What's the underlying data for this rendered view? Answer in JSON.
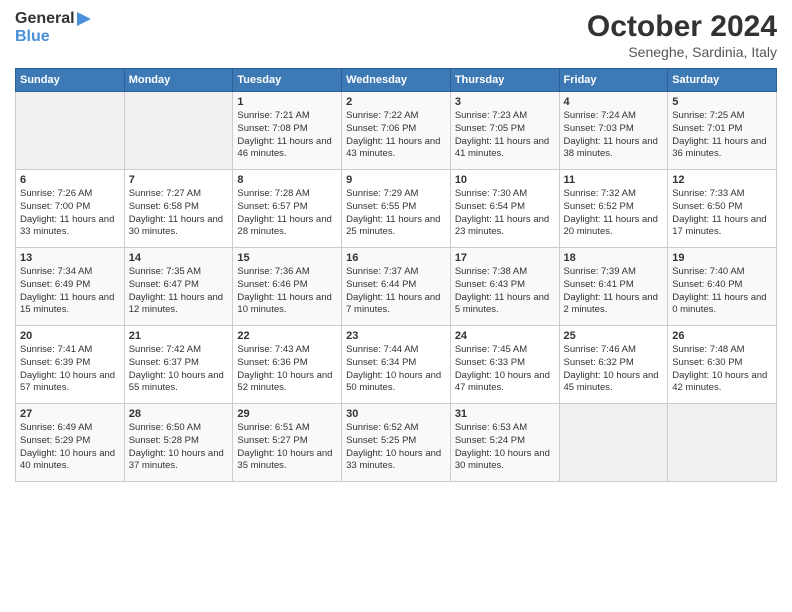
{
  "header": {
    "logo": {
      "line1": "General",
      "line2": "Blue"
    },
    "title": "October 2024",
    "subtitle": "Seneghe, Sardinia, Italy"
  },
  "weekdays": [
    "Sunday",
    "Monday",
    "Tuesday",
    "Wednesday",
    "Thursday",
    "Friday",
    "Saturday"
  ],
  "weeks": [
    [
      {
        "day": "",
        "info": ""
      },
      {
        "day": "",
        "info": ""
      },
      {
        "day": "1",
        "info": "Sunrise: 7:21 AM\nSunset: 7:08 PM\nDaylight: 11 hours and 46 minutes."
      },
      {
        "day": "2",
        "info": "Sunrise: 7:22 AM\nSunset: 7:06 PM\nDaylight: 11 hours and 43 minutes."
      },
      {
        "day": "3",
        "info": "Sunrise: 7:23 AM\nSunset: 7:05 PM\nDaylight: 11 hours and 41 minutes."
      },
      {
        "day": "4",
        "info": "Sunrise: 7:24 AM\nSunset: 7:03 PM\nDaylight: 11 hours and 38 minutes."
      },
      {
        "day": "5",
        "info": "Sunrise: 7:25 AM\nSunset: 7:01 PM\nDaylight: 11 hours and 36 minutes."
      }
    ],
    [
      {
        "day": "6",
        "info": "Sunrise: 7:26 AM\nSunset: 7:00 PM\nDaylight: 11 hours and 33 minutes."
      },
      {
        "day": "7",
        "info": "Sunrise: 7:27 AM\nSunset: 6:58 PM\nDaylight: 11 hours and 30 minutes."
      },
      {
        "day": "8",
        "info": "Sunrise: 7:28 AM\nSunset: 6:57 PM\nDaylight: 11 hours and 28 minutes."
      },
      {
        "day": "9",
        "info": "Sunrise: 7:29 AM\nSunset: 6:55 PM\nDaylight: 11 hours and 25 minutes."
      },
      {
        "day": "10",
        "info": "Sunrise: 7:30 AM\nSunset: 6:54 PM\nDaylight: 11 hours and 23 minutes."
      },
      {
        "day": "11",
        "info": "Sunrise: 7:32 AM\nSunset: 6:52 PM\nDaylight: 11 hours and 20 minutes."
      },
      {
        "day": "12",
        "info": "Sunrise: 7:33 AM\nSunset: 6:50 PM\nDaylight: 11 hours and 17 minutes."
      }
    ],
    [
      {
        "day": "13",
        "info": "Sunrise: 7:34 AM\nSunset: 6:49 PM\nDaylight: 11 hours and 15 minutes."
      },
      {
        "day": "14",
        "info": "Sunrise: 7:35 AM\nSunset: 6:47 PM\nDaylight: 11 hours and 12 minutes."
      },
      {
        "day": "15",
        "info": "Sunrise: 7:36 AM\nSunset: 6:46 PM\nDaylight: 11 hours and 10 minutes."
      },
      {
        "day": "16",
        "info": "Sunrise: 7:37 AM\nSunset: 6:44 PM\nDaylight: 11 hours and 7 minutes."
      },
      {
        "day": "17",
        "info": "Sunrise: 7:38 AM\nSunset: 6:43 PM\nDaylight: 11 hours and 5 minutes."
      },
      {
        "day": "18",
        "info": "Sunrise: 7:39 AM\nSunset: 6:41 PM\nDaylight: 11 hours and 2 minutes."
      },
      {
        "day": "19",
        "info": "Sunrise: 7:40 AM\nSunset: 6:40 PM\nDaylight: 11 hours and 0 minutes."
      }
    ],
    [
      {
        "day": "20",
        "info": "Sunrise: 7:41 AM\nSunset: 6:39 PM\nDaylight: 10 hours and 57 minutes."
      },
      {
        "day": "21",
        "info": "Sunrise: 7:42 AM\nSunset: 6:37 PM\nDaylight: 10 hours and 55 minutes."
      },
      {
        "day": "22",
        "info": "Sunrise: 7:43 AM\nSunset: 6:36 PM\nDaylight: 10 hours and 52 minutes."
      },
      {
        "day": "23",
        "info": "Sunrise: 7:44 AM\nSunset: 6:34 PM\nDaylight: 10 hours and 50 minutes."
      },
      {
        "day": "24",
        "info": "Sunrise: 7:45 AM\nSunset: 6:33 PM\nDaylight: 10 hours and 47 minutes."
      },
      {
        "day": "25",
        "info": "Sunrise: 7:46 AM\nSunset: 6:32 PM\nDaylight: 10 hours and 45 minutes."
      },
      {
        "day": "26",
        "info": "Sunrise: 7:48 AM\nSunset: 6:30 PM\nDaylight: 10 hours and 42 minutes."
      }
    ],
    [
      {
        "day": "27",
        "info": "Sunrise: 6:49 AM\nSunset: 5:29 PM\nDaylight: 10 hours and 40 minutes."
      },
      {
        "day": "28",
        "info": "Sunrise: 6:50 AM\nSunset: 5:28 PM\nDaylight: 10 hours and 37 minutes."
      },
      {
        "day": "29",
        "info": "Sunrise: 6:51 AM\nSunset: 5:27 PM\nDaylight: 10 hours and 35 minutes."
      },
      {
        "day": "30",
        "info": "Sunrise: 6:52 AM\nSunset: 5:25 PM\nDaylight: 10 hours and 33 minutes."
      },
      {
        "day": "31",
        "info": "Sunrise: 6:53 AM\nSunset: 5:24 PM\nDaylight: 10 hours and 30 minutes."
      },
      {
        "day": "",
        "info": ""
      },
      {
        "day": "",
        "info": ""
      }
    ]
  ]
}
